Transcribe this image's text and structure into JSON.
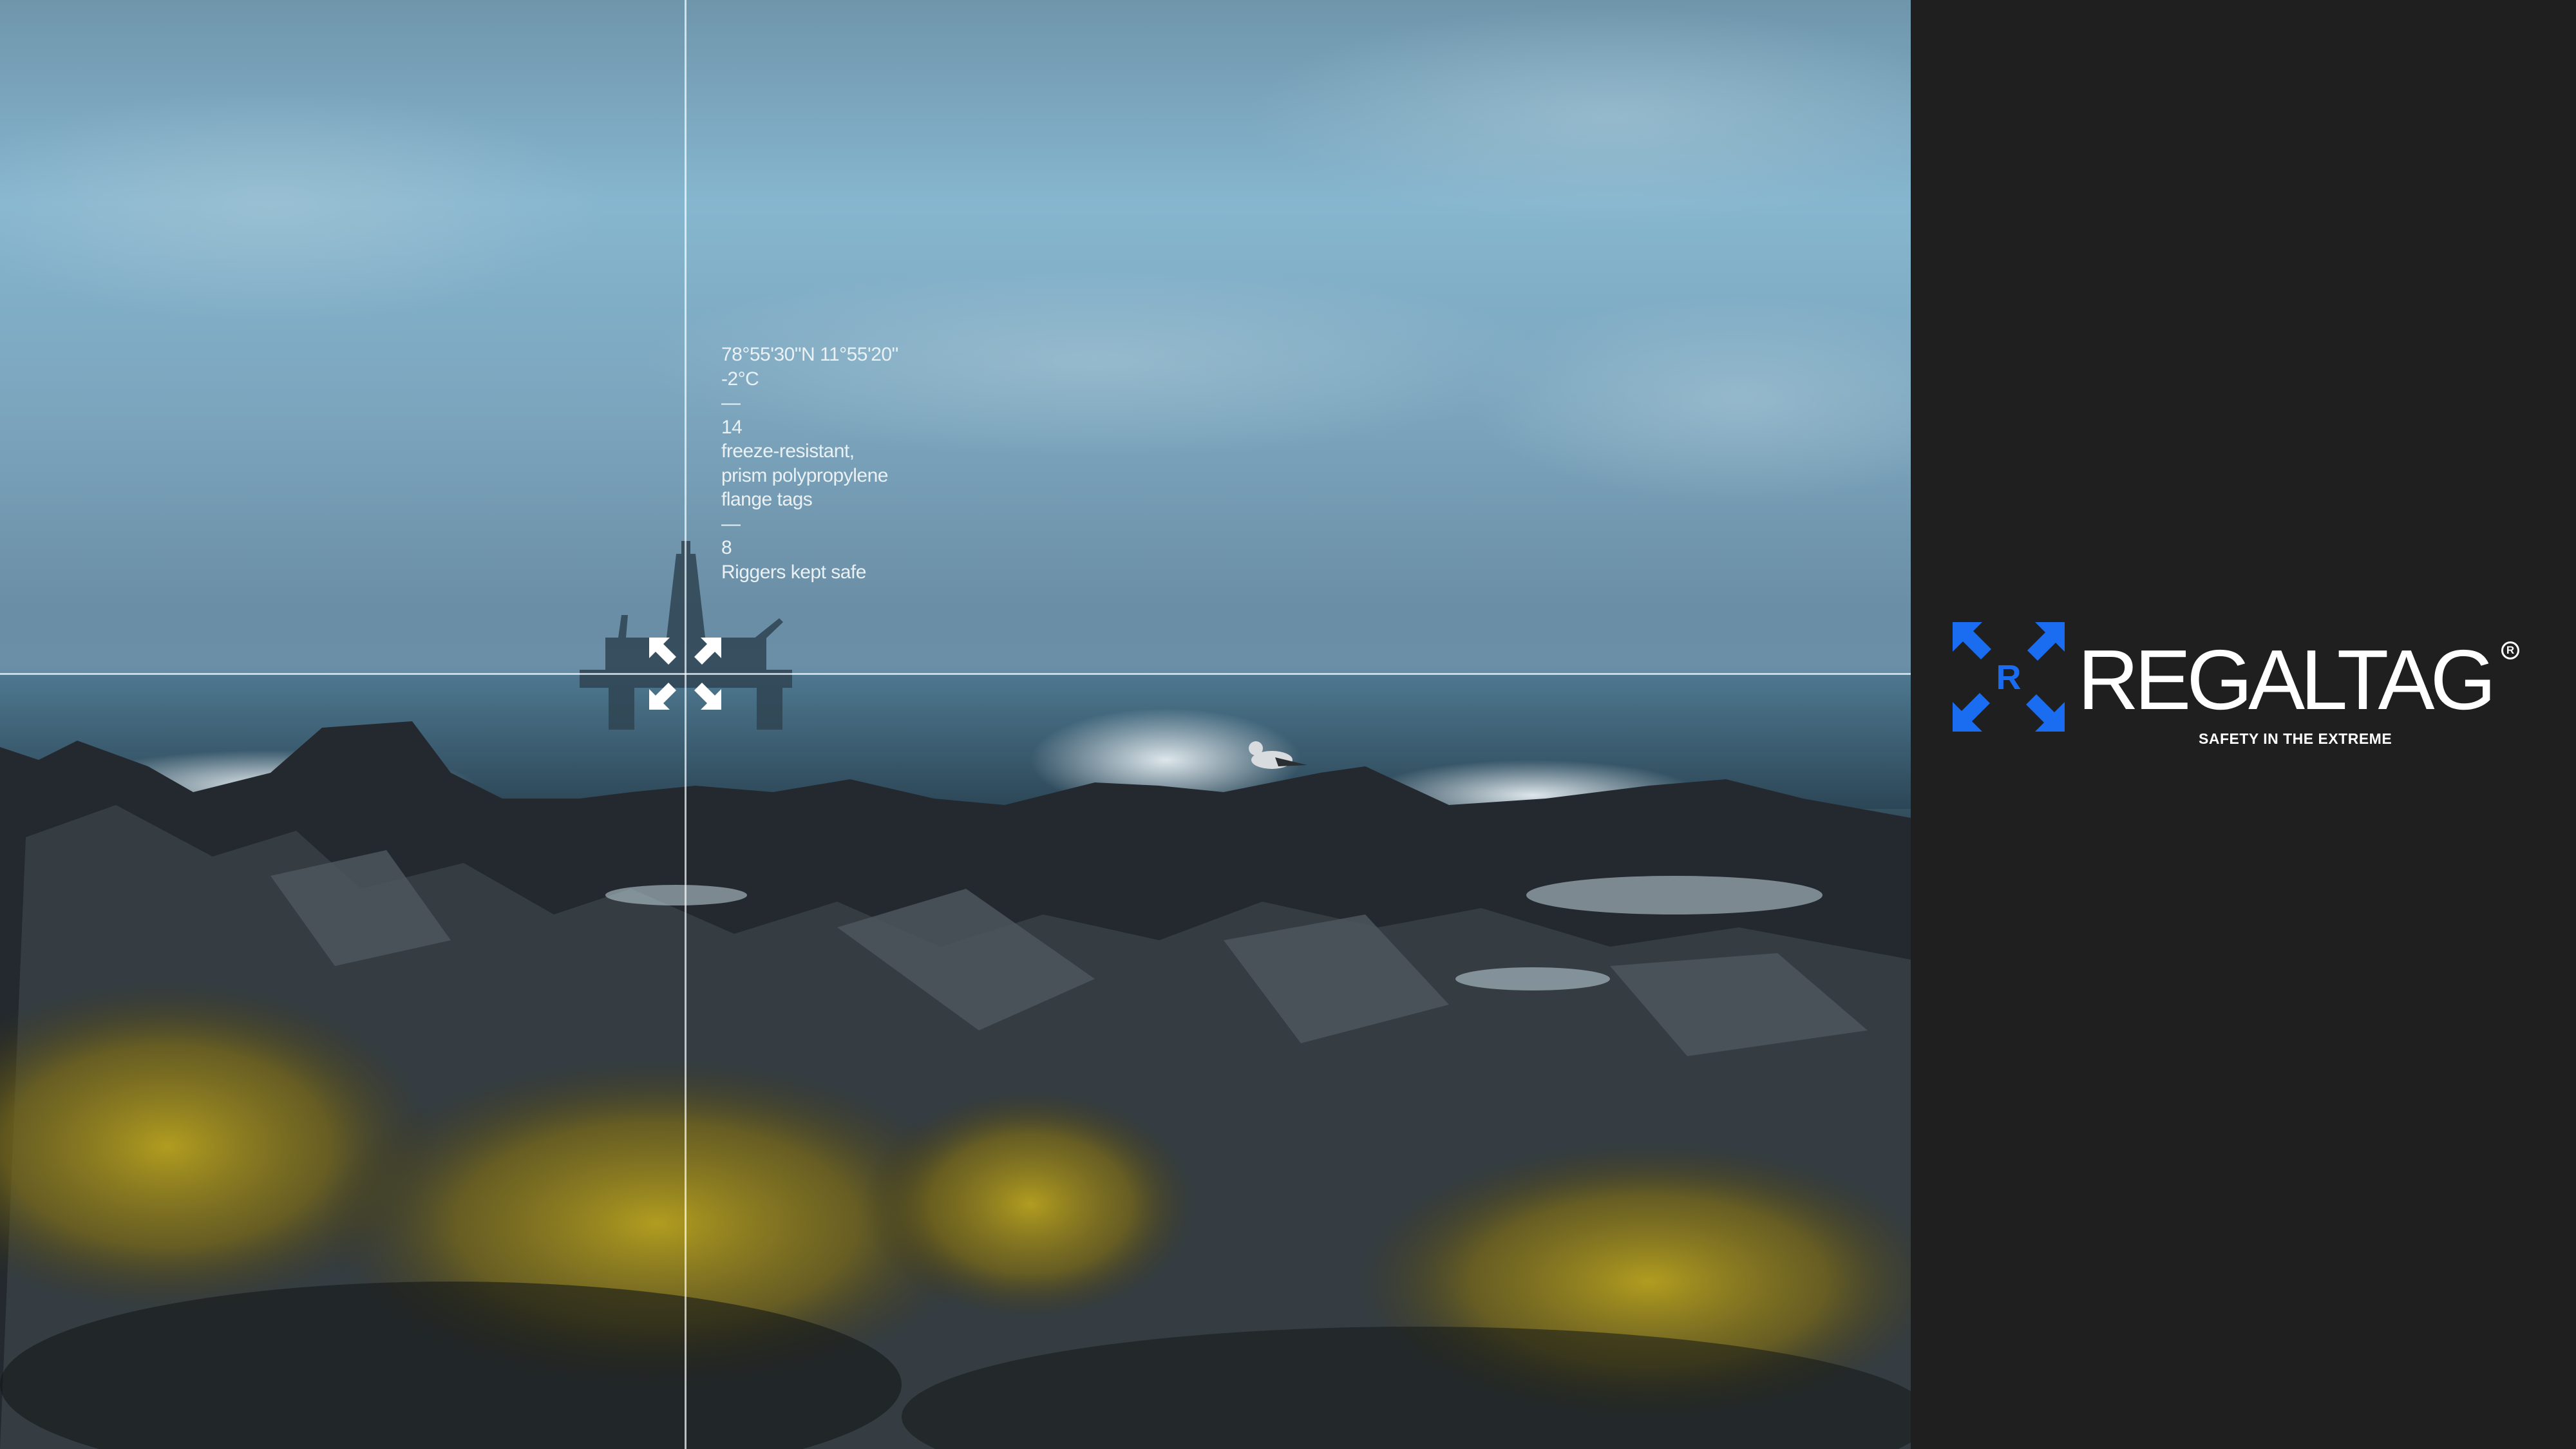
{
  "overlay": {
    "coordinates": "78°55'30\"N 11°55'20\"",
    "temperature": "-2°C",
    "divider_1": "—",
    "tag_count": "14",
    "tag_line_1": "freeze-resistant,",
    "tag_line_2": "prism polypropylene",
    "tag_line_3": "flange tags",
    "divider_2": "—",
    "rigger_count": "8",
    "rigger_label": "Riggers kept safe"
  },
  "brand": {
    "mark_letter": "R",
    "name": "REGALTAG",
    "registered": "R",
    "tagline": "SAFETY IN THE EXTREME",
    "accent_color": "#1a6cf0",
    "panel_color": "#1f1f1f"
  },
  "icons": {
    "target": "crosshair-arrows-icon",
    "logo": "regaltag-arrows-logo-icon"
  }
}
